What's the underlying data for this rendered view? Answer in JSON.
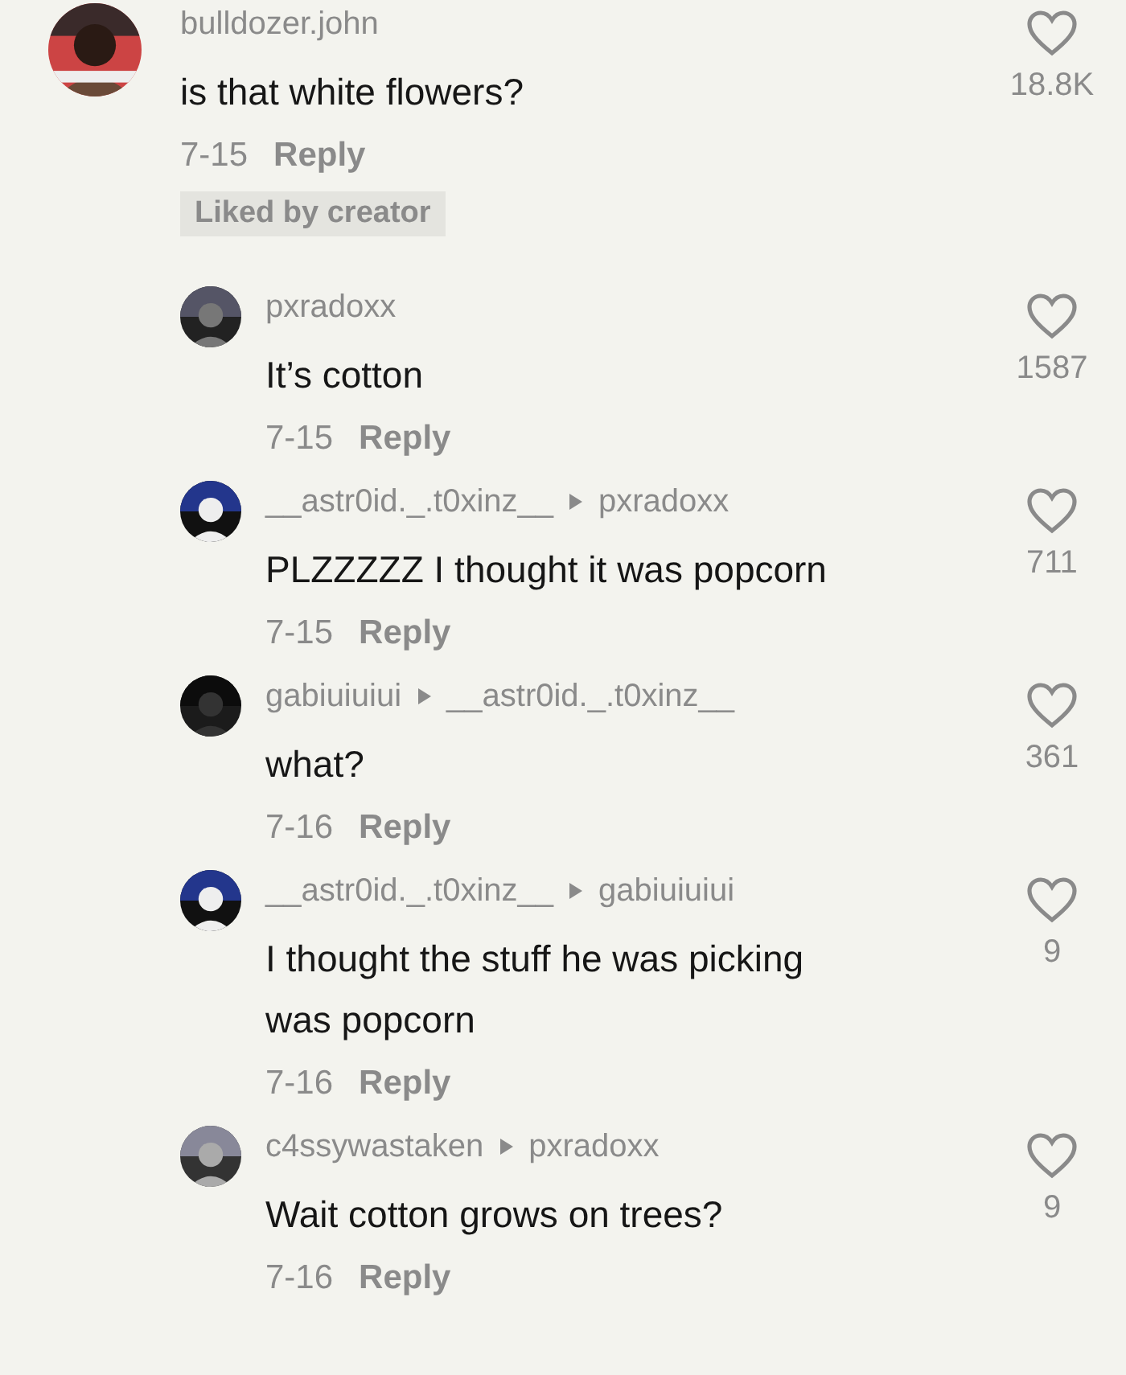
{
  "comments": [
    {
      "user": "bulldozer.john",
      "lines": [
        "is that white flowers?"
      ],
      "date": "7-15",
      "reply": "Reply",
      "badge": "Liked by creator",
      "likes": "18.8K",
      "liked": false,
      "replies": [
        {
          "user": "pxradoxx",
          "lines": [
            "It’s cotton"
          ],
          "date": "7-15",
          "reply": "Reply",
          "likes": "1587",
          "liked": false
        },
        {
          "user": "__astr0id._.t0xinz__",
          "reply_to": "pxradoxx",
          "lines": [
            "PLZZZZZ I thought it was popcorn"
          ],
          "date": "7-15",
          "reply": "Reply",
          "likes": "711",
          "liked": false
        },
        {
          "user": "gabiuiuiui",
          "reply_to": "__astr0id._.t0xinz__",
          "lines": [
            "what?"
          ],
          "date": "7-16",
          "reply": "Reply",
          "likes": "361",
          "liked": false
        },
        {
          "user": "__astr0id._.t0xinz__",
          "reply_to": "gabiuiuiui",
          "lines": [
            "I thought the stuff he was picking",
            "was popcorn"
          ],
          "date": "7-16",
          "reply": "Reply",
          "likes": "9",
          "liked": false
        },
        {
          "user": "c4ssywastaken",
          "reply_to": "pxradoxx",
          "lines": [
            "Wait cotton grows on trees?"
          ],
          "date": "7-16",
          "reply": "Reply",
          "likes": "9",
          "liked": false
        }
      ]
    }
  ]
}
